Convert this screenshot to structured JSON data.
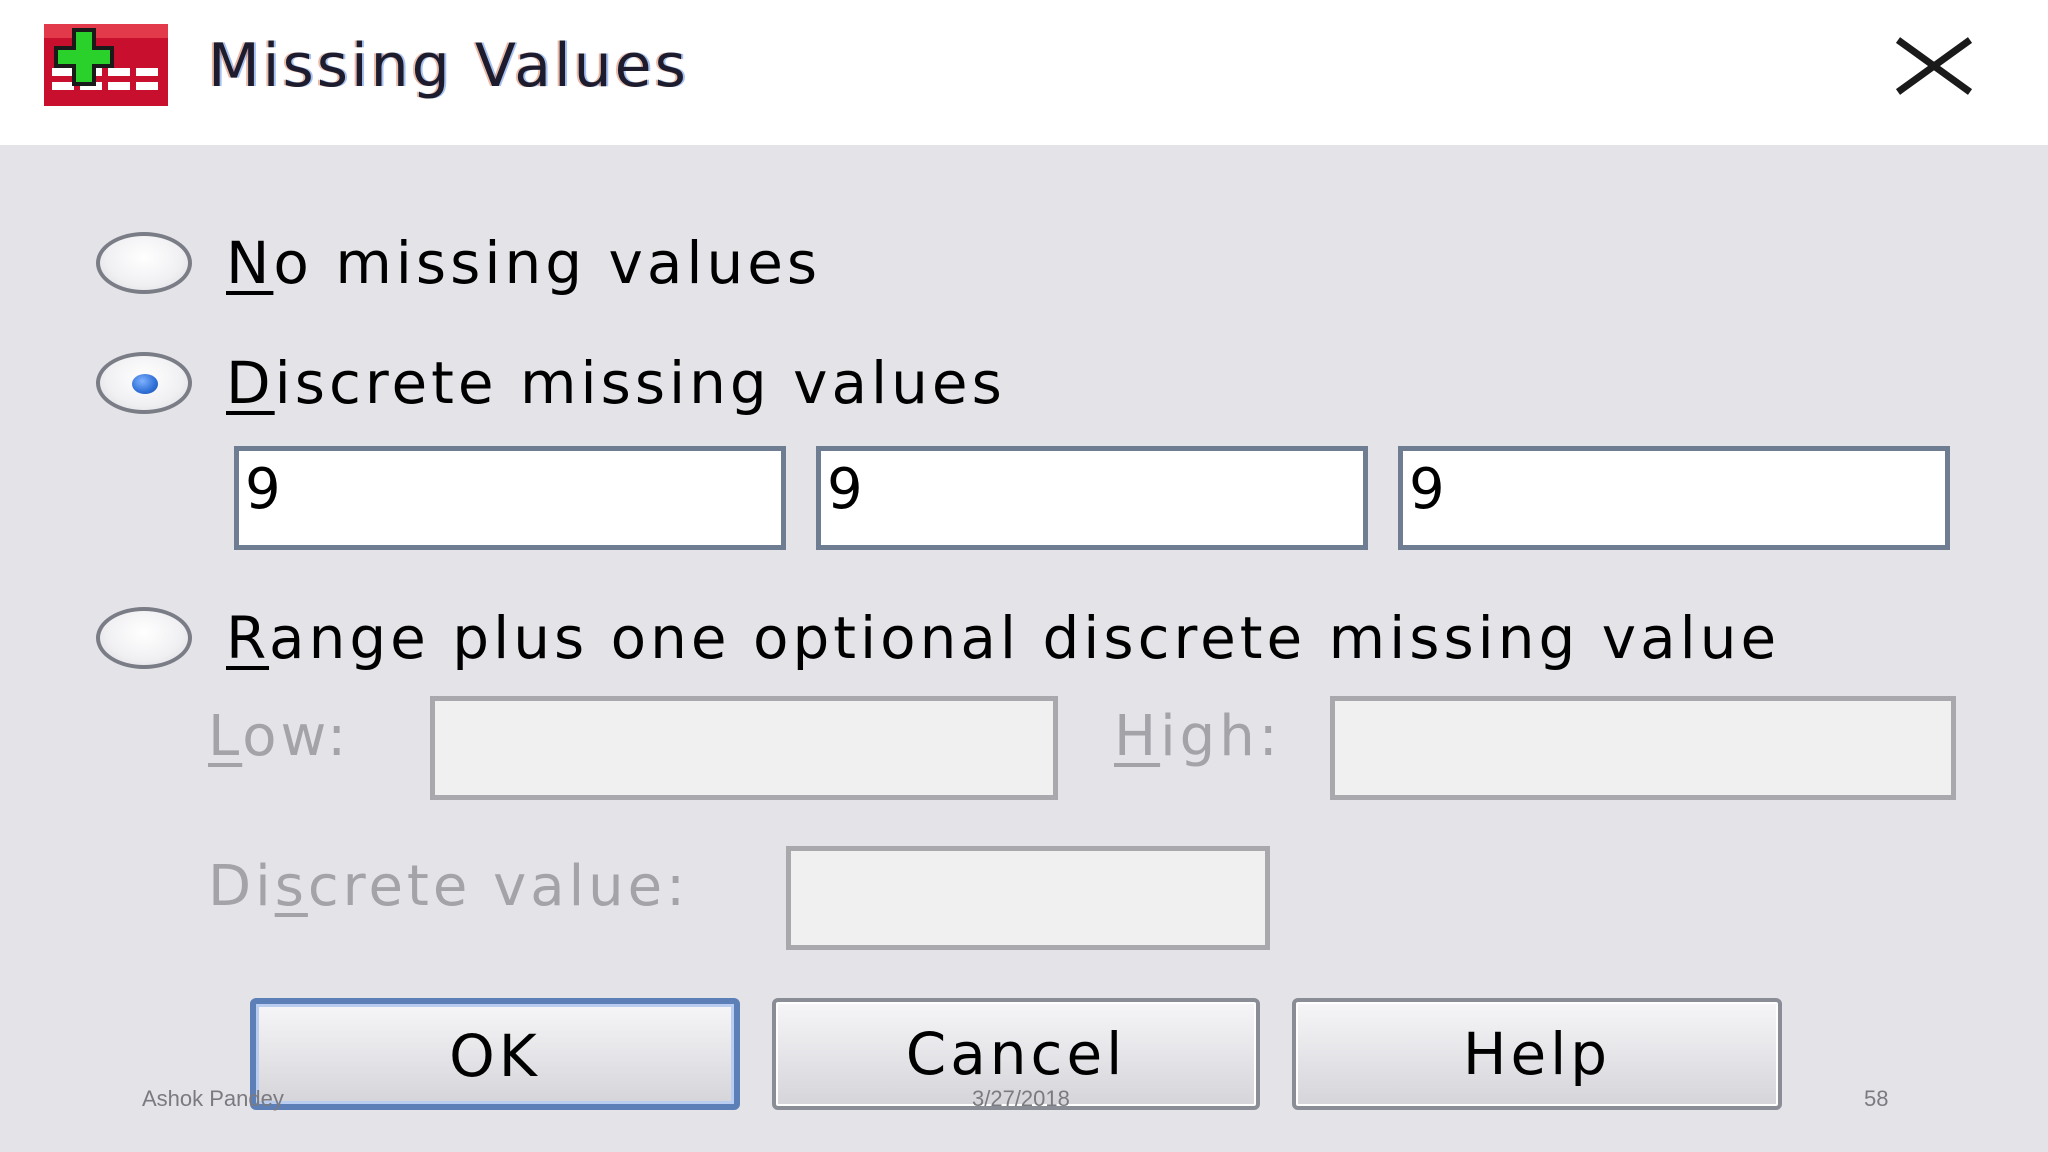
{
  "dialog": {
    "title": "Missing Values",
    "icon": "spss-data-table-icon",
    "close_icon": "close-icon"
  },
  "options": {
    "no_missing": {
      "label_u": "N",
      "label_rest": "o missing values",
      "selected": false
    },
    "discrete": {
      "label_u": "D",
      "label_rest": "iscrete missing values",
      "selected": true
    },
    "range": {
      "label_u": "R",
      "label_rest": "ange plus one optional discrete missing value",
      "selected": false
    }
  },
  "discrete_values": [
    "9",
    "9",
    "9"
  ],
  "range": {
    "low_u": "L",
    "low_rest": "ow:",
    "low_value": "",
    "high_u": "H",
    "high_rest": "igh:",
    "high_value": "",
    "discrete_pre": "Di",
    "discrete_u": "s",
    "discrete_rest": "crete value:",
    "discrete_value": ""
  },
  "buttons": {
    "ok": "OK",
    "cancel": "Cancel",
    "help": "Help"
  },
  "footer": {
    "author": "Ashok Pandey",
    "date": "3/27/2018",
    "page": "58"
  },
  "colors": {
    "selected_radio": "#2f6fd6",
    "default_button_border": "#5c7fb8",
    "disabled_text": "#a3a3a8"
  }
}
